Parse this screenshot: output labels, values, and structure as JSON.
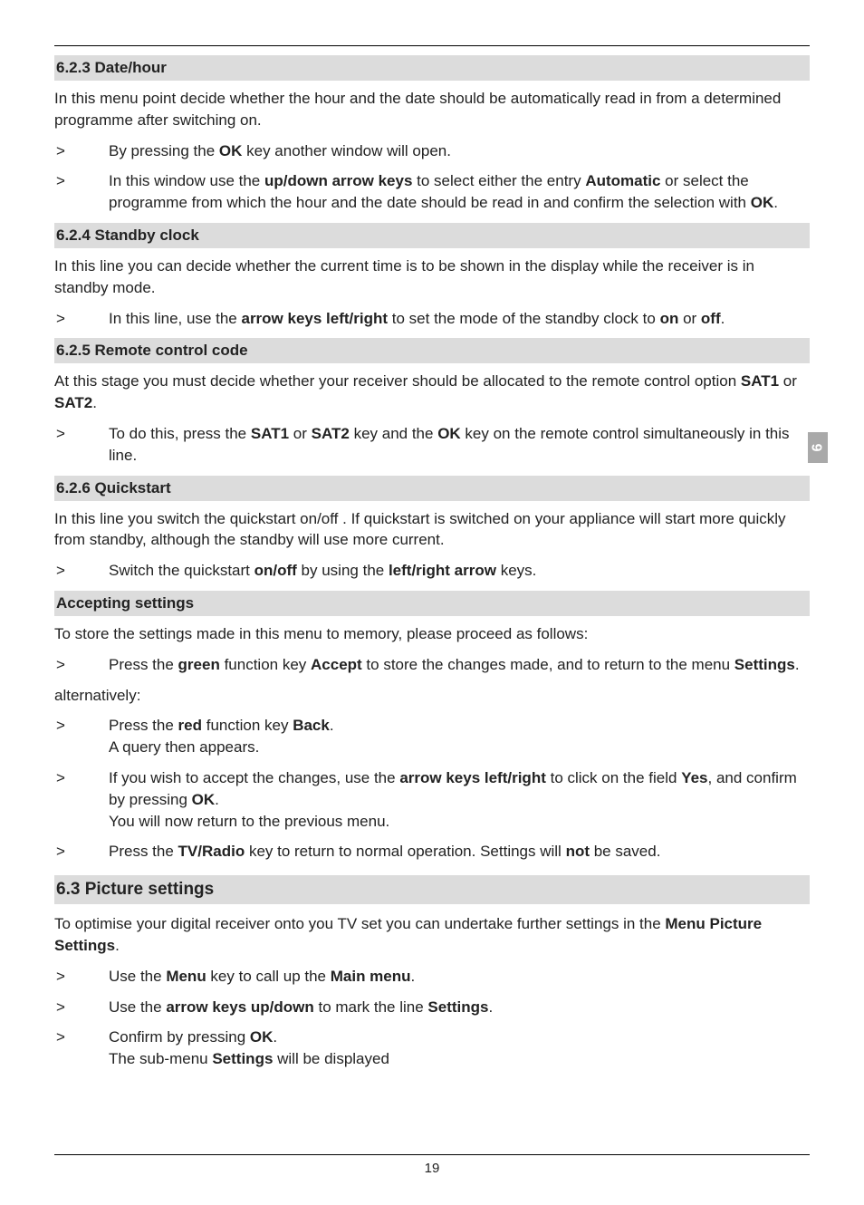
{
  "side_tab": "6",
  "page_number": "19",
  "sections": {
    "s623": {
      "heading": "6.2.3 Date/hour",
      "intro": "In this menu point decide whether the hour and the date should be automatically read in from a determined programme after switching on.",
      "step1_a": "By pressing the ",
      "step1_b": "OK",
      "step1_c": " key another window will open.",
      "step2_a": "In this window use the ",
      "step2_b": "up/down arrow keys",
      "step2_c": " to select either the entry ",
      "step2_d": "Automatic",
      "step2_e": " or select the programme from which the hour and the date should be read in and confirm the selection with ",
      "step2_f": "OK",
      "step2_g": "."
    },
    "s624": {
      "heading": "6.2.4 Standby clock",
      "intro": "In this line you can decide whether the current time is to be shown in the display while the receiver is in standby mode.",
      "step1_a": "In this line, use the ",
      "step1_b": "arrow keys left/right",
      "step1_c": " to set the mode of the standby clock to ",
      "step1_d": "on",
      "step1_e": " or ",
      "step1_f": "off",
      "step1_g": "."
    },
    "s625": {
      "heading": "6.2.5 Remote control code",
      "intro_a": "At this stage you must decide whether your receiver should be allocated to the remote control option ",
      "intro_b": "SAT1",
      "intro_c": " or ",
      "intro_d": "SAT2",
      "intro_e": ".",
      "step1_a": "To do this, press the ",
      "step1_b": "SAT1",
      "step1_c": " or ",
      "step1_d": "SAT2",
      "step1_e": " key and the ",
      "step1_f": "OK",
      "step1_g": " key on the remote control simultaneously in this line."
    },
    "s626": {
      "heading": "6.2.6 Quickstart",
      "intro": "In this line you switch the quickstart on/off . If quickstart is switched on your appliance will start more quickly from standby, although the standby will use more current.",
      "step1_a": "Switch the quickstart ",
      "step1_b": "on/off",
      "step1_c": " by using the ",
      "step1_d": "left/right arrow",
      "step1_e": " keys."
    },
    "accept": {
      "heading": "Accepting settings",
      "intro": "To store the settings made in this menu to memory, please proceed as follows:",
      "step1_a": "Press the ",
      "step1_b": "green",
      "step1_c": " function key ",
      "step1_d": "Accept",
      "step1_e": " to store the changes made, and to return to the menu ",
      "step1_f": "Settings",
      "step1_g": ".",
      "alt": "alternatively:",
      "step2_a": "Press the ",
      "step2_b": "red",
      "step2_c": " function key ",
      "step2_d": "Back",
      "step2_e": ".",
      "step2_f": "A query then appears.",
      "step3_a": "If you wish to accept the changes, use the ",
      "step3_b": "arrow keys left/right",
      "step3_c": " to click on the field ",
      "step3_d": "Yes",
      "step3_e": ", and confirm by pressing ",
      "step3_f": "OK",
      "step3_g": ".",
      "step3_h": "You will now return to the previous menu.",
      "step4_a": "Press the ",
      "step4_b": "TV/Radio",
      "step4_c": " key to return to normal operation. Settings will ",
      "step4_d": "not",
      "step4_e": " be saved."
    },
    "s63": {
      "heading": "6.3 Picture settings",
      "intro_a": "To optimise your digital receiver onto you TV set you can undertake further settings in the ",
      "intro_b": "Menu Picture Settings",
      "intro_c": ".",
      "step1_a": "Use the ",
      "step1_b": "Menu",
      "step1_c": " key to call up the ",
      "step1_d": "Main menu",
      "step1_e": ".",
      "step2_a": "Use the ",
      "step2_b": "arrow keys up/down",
      "step2_c": " to mark the line ",
      "step2_d": "Settings",
      "step2_e": ".",
      "step3_a": "Confirm by pressing ",
      "step3_b": "OK",
      "step3_c": ".",
      "step3_d": "The sub-menu ",
      "step3_e": "Settings",
      "step3_f": " will be displayed"
    }
  }
}
